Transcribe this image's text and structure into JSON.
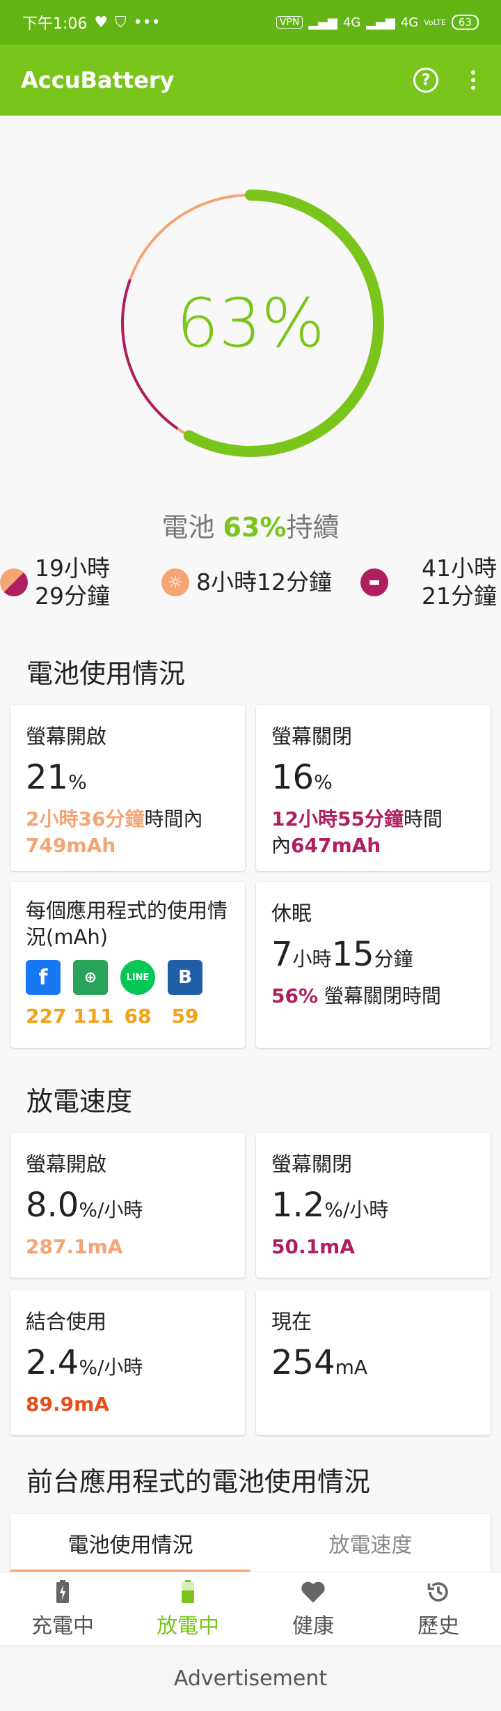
{
  "status_bar": {
    "time": "下午1:06",
    "vpn": "VPN",
    "network1": "4G",
    "network2": "4G",
    "volte": "VoLTE",
    "battery": "63"
  },
  "app_bar": {
    "title": "AccuBattery"
  },
  "gauge": {
    "percent_text": "63%",
    "level": 0.63
  },
  "battery_lasts": {
    "prefix": "電池 ",
    "percent": "63%",
    "suffix": "持續"
  },
  "estimates": {
    "combined_line1": "19小時",
    "combined_line2": "29分鐘",
    "screen_on": "8小時12分鐘",
    "sleep_line1": "41小時",
    "sleep_line2": "21分鐘"
  },
  "battery_usage": {
    "title": "電池使用情況",
    "screen_on": {
      "label": "螢幕開啟",
      "value": "21",
      "unit": "%",
      "duration": "2小時36分鐘",
      "within": "時間內",
      "mah": "749mAh"
    },
    "screen_off": {
      "label": "螢幕關閉",
      "value": "16",
      "unit": "%",
      "duration": "12小時55分鐘",
      "within_part1": "時間",
      "within_part2": "內",
      "mah": "647mAh"
    },
    "per_app": {
      "label": "每個應用程式的使用情況(mAh)",
      "counts": [
        "227",
        "111",
        "68",
        "59"
      ]
    },
    "sleep": {
      "label": "休眠",
      "hours": "7",
      "hours_unit": "小時",
      "minutes": "15",
      "minutes_unit": "分鐘",
      "pct": "56%",
      "pct_desc": " 螢幕關閉時間"
    }
  },
  "discharge_speed": {
    "title": "放電速度",
    "screen_on": {
      "label": "螢幕開啟",
      "value": "8.0",
      "unit": "%/小時",
      "ma": "287.1mA"
    },
    "screen_off": {
      "label": "螢幕關閉",
      "value": "1.2",
      "unit": "%/小時",
      "ma": "50.1mA"
    },
    "combined": {
      "label": "結合使用",
      "value": "2.4",
      "unit": "%/小時",
      "ma": "89.9mA"
    },
    "now": {
      "label": "現在",
      "value": "254",
      "unit": "mA"
    }
  },
  "foreground": {
    "title": "前台應用程式的電池使用情況",
    "tabs": [
      "電池使用情況",
      "放電速度"
    ]
  },
  "bottom_nav": {
    "items": [
      "充電中",
      "放電中",
      "健康",
      "歷史"
    ]
  },
  "ad": {
    "label": "Advertisement"
  },
  "colors": {
    "brand_green": "#7ac51c",
    "status_green": "#62b515",
    "screen_on_peach": "#f3a574",
    "screen_off_plum": "#b01e5f",
    "combined_red": "#e84e1b",
    "app_count_orange": "#f0a21a"
  }
}
